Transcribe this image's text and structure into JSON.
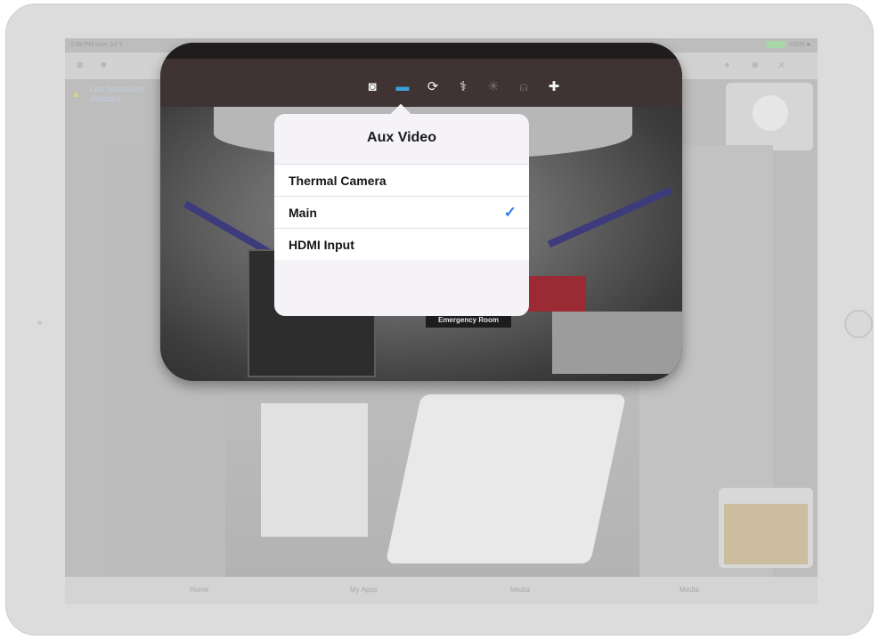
{
  "statusbar": {
    "time": "2:59 PM  Mon Jul 5",
    "right": "100% ■"
  },
  "alert": {
    "line1": "Low bandwidth",
    "line2": "detected"
  },
  "toolbar": {
    "icons": [
      "camera-icon",
      "aux-video-icon",
      "rotate-icon",
      "stethoscope-icon",
      "pattern-icon",
      "hand-icon",
      "add-user-icon"
    ]
  },
  "popover": {
    "title": "Aux Video",
    "options": [
      {
        "label": "Thermal Camera",
        "selected": false
      },
      {
        "label": "Main",
        "selected": true
      },
      {
        "label": "HDMI Input",
        "selected": false
      }
    ],
    "check_mark": "✓"
  },
  "camera": {
    "sign": "Emergency Room"
  },
  "bottom_nav": {
    "items": [
      "Home",
      "My Apps",
      "Media",
      "Media"
    ]
  },
  "colors": {
    "accent": "#3aa2d8",
    "check": "#2f7ee8",
    "popover_bg": "#f5f3f7"
  }
}
